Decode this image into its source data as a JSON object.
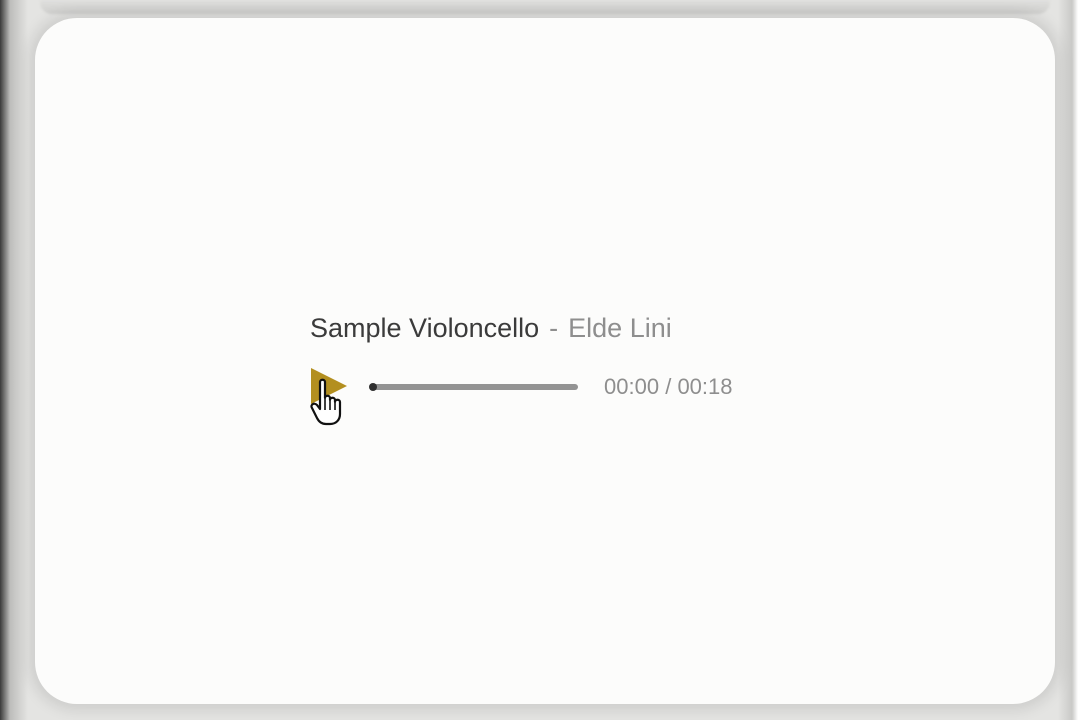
{
  "player": {
    "title": "Sample Violoncello",
    "separator": "-",
    "artist": "Elde Lini",
    "current_time": "00:00",
    "time_separator": "/",
    "duration": "00:18",
    "progress": 0.0,
    "accent_color": "#b38f1f"
  },
  "cursor": {
    "icon": "hand-pointer-icon"
  }
}
